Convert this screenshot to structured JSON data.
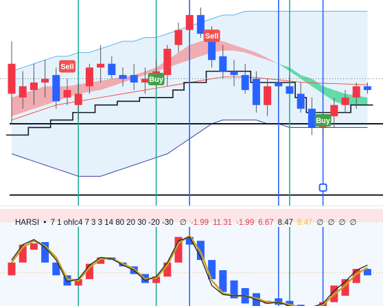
{
  "indicator": {
    "name": "HARSI",
    "dot": "•",
    "params": "7 1 ohlc4 7 3 3 14 80 20 30 -20 -30",
    "values": [
      {
        "text": "∅",
        "color": "#333333"
      },
      {
        "text": "-1.99",
        "color": "#e53949"
      },
      {
        "text": "11.31",
        "color": "#e53949"
      },
      {
        "text": "-1.99",
        "color": "#e53949"
      },
      {
        "text": "6.67",
        "color": "#e53949"
      },
      {
        "text": "8.47",
        "color": "#222222"
      },
      {
        "text": "8.47",
        "color": "#f2c230"
      },
      {
        "text": "∅",
        "color": "#333333"
      },
      {
        "text": "∅",
        "color": "#333333"
      },
      {
        "text": "∅",
        "color": "#333333"
      },
      {
        "text": "∅",
        "color": "#333333"
      }
    ]
  },
  "signals": [
    {
      "label": "Sell",
      "bar": 5,
      "y": 96.5,
      "type": "sell"
    },
    {
      "label": "Buy",
      "bar": 13,
      "y": 115,
      "type": "buy"
    },
    {
      "label": "Sell",
      "bar": 18,
      "y": 52,
      "type": "sell"
    },
    {
      "label": "Buy",
      "bar": 28,
      "y": 175,
      "type": "buy"
    }
  ],
  "colors": {
    "up": "#f23645",
    "down": "#2962ff",
    "teal": "#22ab94",
    "blue_line": "#2962ff",
    "cloud_green": "#4fd69a",
    "cloud_red": "#f2a0a6",
    "band_fill": "#e1f0fb"
  },
  "chart_data": [
    {
      "type": "candlestick",
      "title": "",
      "candles": [
        {
          "o": 104,
          "h": 118,
          "l": 96,
          "c": 112
        },
        {
          "o": 103,
          "h": 110,
          "l": 100,
          "c": 106
        },
        {
          "o": 105,
          "h": 112,
          "l": 101,
          "c": 107
        },
        {
          "o": 107,
          "h": 113,
          "l": 103,
          "c": 108
        },
        {
          "o": 109,
          "h": 111,
          "l": 100,
          "c": 102
        },
        {
          "o": 103,
          "h": 108,
          "l": 101,
          "c": 105
        },
        {
          "o": 101,
          "h": 107,
          "l": 97,
          "c": 104
        },
        {
          "o": 106,
          "h": 112,
          "l": 104,
          "c": 111
        },
        {
          "o": 111,
          "h": 117,
          "l": 107,
          "c": 112
        },
        {
          "o": 112,
          "h": 114,
          "l": 108,
          "c": 109
        },
        {
          "o": 109,
          "h": 111,
          "l": 106,
          "c": 108
        },
        {
          "o": 109,
          "h": 112,
          "l": 105,
          "c": 107
        },
        {
          "o": 107,
          "h": 111,
          "l": 104,
          "c": 108
        },
        {
          "o": 108,
          "h": 113,
          "l": 106,
          "c": 110
        },
        {
          "o": 109,
          "h": 117,
          "l": 106,
          "c": 116
        },
        {
          "o": 117,
          "h": 123,
          "l": 115,
          "c": 121
        },
        {
          "o": 121,
          "h": 126,
          "l": 118,
          "c": 125
        },
        {
          "o": 125,
          "h": 127,
          "l": 119,
          "c": 120
        },
        {
          "o": 120,
          "h": 122,
          "l": 111,
          "c": 113
        },
        {
          "o": 114,
          "h": 117,
          "l": 108,
          "c": 110
        },
        {
          "o": 110,
          "h": 113,
          "l": 106,
          "c": 109
        },
        {
          "o": 109,
          "h": 112,
          "l": 104,
          "c": 105
        },
        {
          "o": 108,
          "h": 110,
          "l": 99,
          "c": 101
        },
        {
          "o": 101,
          "h": 108,
          "l": 98,
          "c": 106
        },
        {
          "o": 107,
          "h": 109,
          "l": 103,
          "c": 106
        },
        {
          "o": 106,
          "h": 109,
          "l": 104,
          "c": 104
        },
        {
          "o": 104,
          "h": 107,
          "l": 99,
          "c": 100
        },
        {
          "o": 100,
          "h": 103,
          "l": 93,
          "c": 95
        },
        {
          "o": 95,
          "h": 99,
          "l": 93,
          "c": 98
        },
        {
          "o": 98,
          "h": 103,
          "l": 95,
          "c": 101
        },
        {
          "o": 101,
          "h": 105,
          "l": 99,
          "c": 103
        },
        {
          "o": 103,
          "h": 107,
          "l": 100,
          "c": 106
        },
        {
          "o": 106,
          "h": 107,
          "l": 104,
          "c": 105
        }
      ],
      "upper_band": [
        110,
        111,
        112,
        113,
        114,
        114,
        115,
        115,
        116,
        117,
        118,
        118,
        119,
        119,
        120,
        121,
        122,
        123,
        124,
        125,
        125,
        126,
        126,
        126,
        126,
        126,
        126,
        126,
        126,
        126,
        126,
        126,
        126
      ],
      "lower_band": [
        88,
        87,
        86,
        85,
        84,
        83,
        82,
        82,
        82,
        83,
        84,
        85,
        86,
        87,
        88,
        90,
        92,
        94,
        96,
        97,
        97,
        97,
        97,
        96,
        96,
        95,
        95,
        95,
        95,
        95,
        95,
        95,
        95
      ],
      "cloud_a": [
        103,
        104,
        105,
        106,
        106,
        106,
        106.5,
        107,
        107.5,
        108,
        108.5,
        109,
        110,
        111,
        113,
        115,
        117,
        118,
        118.5,
        118,
        117,
        116,
        115,
        113.5,
        112,
        110,
        108,
        106,
        104,
        102,
        101,
        101,
        101
      ],
      "cloud_b": [
        98,
        99,
        100,
        101,
        102,
        103,
        104,
        104.5,
        105,
        106,
        107,
        108,
        109,
        110,
        111,
        112,
        113,
        114,
        115,
        115.5,
        115.5,
        115,
        114,
        113,
        112,
        111,
        109,
        108,
        106,
        105,
        104,
        103.5,
        103
      ],
      "basis": [
        97,
        98,
        99,
        100,
        101,
        101.5,
        102,
        102.5,
        103,
        103.5,
        104,
        104.5,
        105,
        105.5,
        106,
        106.5,
        107,
        107.5,
        108,
        108.5,
        108.5,
        108.5,
        108.3,
        108,
        107.7,
        107.4,
        107.1,
        106.9,
        106.8,
        106.7,
        106.6,
        106.5,
        106.4
      ],
      "trail": [
        93,
        93,
        95,
        95,
        97,
        97,
        99,
        99,
        101,
        101,
        102,
        102,
        103,
        103,
        103,
        105,
        107,
        107,
        110,
        110,
        110,
        110,
        107,
        107,
        107,
        107,
        103,
        99,
        99,
        99,
        99,
        101,
        101
      ],
      "hlines": [
        96,
        77
      ],
      "ylim": [
        74,
        129
      ],
      "vlines": [
        {
          "bar": 6,
          "color": "teal"
        },
        {
          "bar": 13,
          "color": "teal"
        },
        {
          "bar": 16,
          "color": "blue"
        },
        {
          "bar": 24,
          "color": "blue"
        },
        {
          "bar": 25,
          "color": "teal"
        },
        {
          "bar": 28,
          "color": "blue"
        }
      ],
      "marker": {
        "bar": 28,
        "y": 79
      }
    },
    {
      "type": "candlestick",
      "title": "HARSI",
      "ylim": [
        -46,
        32
      ],
      "ob_zone": [
        20,
        30
      ],
      "dotted_levels": [
        20,
        -20
      ],
      "candles": [
        {
          "o": -22,
          "c": -12
        },
        {
          "o": -12,
          "c": 2
        },
        {
          "o": -2,
          "c": 3
        },
        {
          "o": 4,
          "c": -12
        },
        {
          "o": -12,
          "c": -22
        },
        {
          "o": -22,
          "c": -30
        },
        {
          "o": -30,
          "c": -25
        },
        {
          "o": -25,
          "c": -13
        },
        {
          "o": -13,
          "c": -8
        },
        {
          "o": -8,
          "c": -10
        },
        {
          "o": -12,
          "c": -15
        },
        {
          "o": -15,
          "c": -21
        },
        {
          "o": -21,
          "c": -28
        },
        {
          "o": -28,
          "c": -23
        },
        {
          "o": -23,
          "c": -12
        },
        {
          "o": -12,
          "c": 8
        },
        {
          "o": 8,
          "c": 2
        },
        {
          "o": 5,
          "c": -10
        },
        {
          "o": -10,
          "c": -25
        },
        {
          "o": -18,
          "c": -35
        },
        {
          "o": -26,
          "c": -40
        },
        {
          "o": -32,
          "c": -44
        },
        {
          "o": -36,
          "c": -48
        },
        {
          "o": -44,
          "c": -42
        },
        {
          "o": -40,
          "c": -45
        },
        {
          "o": -42,
          "c": -50
        },
        {
          "o": -45,
          "c": -52
        },
        {
          "o": -50,
          "c": -48
        },
        {
          "o": -48,
          "c": -43
        },
        {
          "o": -43,
          "c": -30
        },
        {
          "o": -38,
          "c": -25
        },
        {
          "o": -28,
          "c": -17
        },
        {
          "o": -17,
          "c": -22
        }
      ],
      "k_line": [
        -10,
        2,
        6,
        0,
        -10,
        -27,
        -25,
        -14,
        -8,
        -9,
        -14,
        -18,
        -26,
        -23,
        -12,
        5,
        8,
        -8,
        -30,
        -37,
        -38,
        -38,
        -41,
        -44,
        -43,
        -46,
        -48,
        -47,
        -44,
        -34,
        -27,
        -18,
        -14
      ],
      "d_line": [
        -12,
        0,
        5,
        1,
        -8,
        -25,
        -26,
        -16,
        -9,
        -9,
        -13,
        -17,
        -25,
        -24,
        -14,
        3,
        9,
        -4,
        -26,
        -36,
        -38,
        -38,
        -40,
        -43,
        -43,
        -45,
        -47,
        -47,
        -45,
        -37,
        -30,
        -21,
        -16
      ],
      "vlines": [
        {
          "bar": 6,
          "color": "teal"
        },
        {
          "bar": 13,
          "color": "teal"
        },
        {
          "bar": 16,
          "color": "blue"
        },
        {
          "bar": 24,
          "color": "blue"
        },
        {
          "bar": 25,
          "color": "teal"
        },
        {
          "bar": 28,
          "color": "blue"
        }
      ]
    }
  ]
}
